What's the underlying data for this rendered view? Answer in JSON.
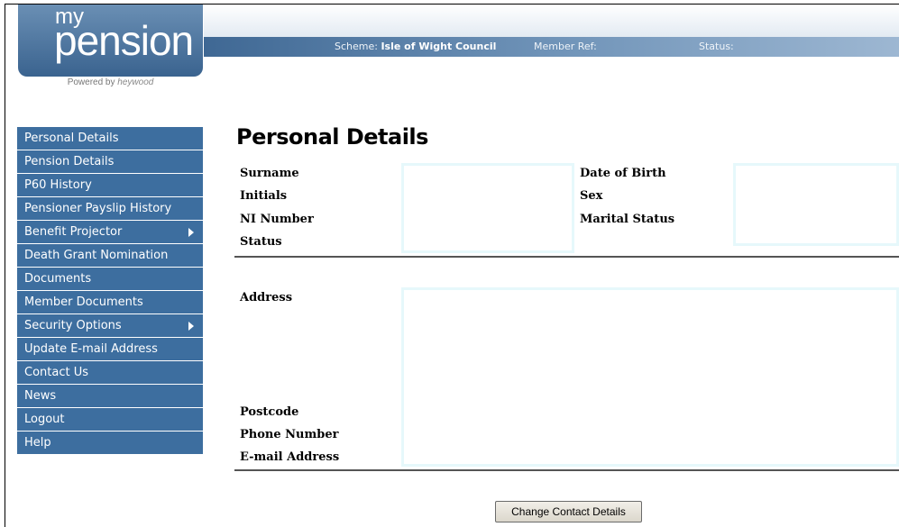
{
  "logo": {
    "my": "my",
    "pension": "pension",
    "powered_by": "Powered by",
    "brand": "heywood"
  },
  "infobar": {
    "scheme_label": "Scheme:",
    "scheme_value": "Isle of Wight Council",
    "member_ref_label": "Member Ref:",
    "status_label": "Status:"
  },
  "sidebar": {
    "items": [
      {
        "label": "Personal Details",
        "submenu": false
      },
      {
        "label": "Pension Details",
        "submenu": false
      },
      {
        "label": "P60 History",
        "submenu": false
      },
      {
        "label": "Pensioner Payslip History",
        "submenu": false
      },
      {
        "label": "Benefit Projector",
        "submenu": true
      },
      {
        "label": "Death Grant Nomination",
        "submenu": false
      },
      {
        "label": "Documents",
        "submenu": false
      },
      {
        "label": "Member Documents",
        "submenu": false
      },
      {
        "label": "Security Options",
        "submenu": true
      },
      {
        "label": "Update E-mail Address",
        "submenu": false
      },
      {
        "label": "Contact Us",
        "submenu": false
      },
      {
        "label": "News",
        "submenu": false
      },
      {
        "label": "Logout",
        "submenu": false
      },
      {
        "label": "Help",
        "submenu": false
      }
    ]
  },
  "main": {
    "title": "Personal Details",
    "labels": {
      "surname": "Surname",
      "initials": "Initials",
      "ni_number": "NI Number",
      "status": "Status",
      "date_of_birth": "Date of Birth",
      "sex": "Sex",
      "marital_status": "Marital Status",
      "address": "Address",
      "postcode": "Postcode",
      "phone_number": "Phone Number",
      "email_address": "E-mail Address"
    },
    "button_label": "Change Contact Details"
  },
  "colors": {
    "nav_bg": "#3d6e9f",
    "infobar_bg": "#3f6894",
    "value_box_border": "#e6f8fb"
  }
}
